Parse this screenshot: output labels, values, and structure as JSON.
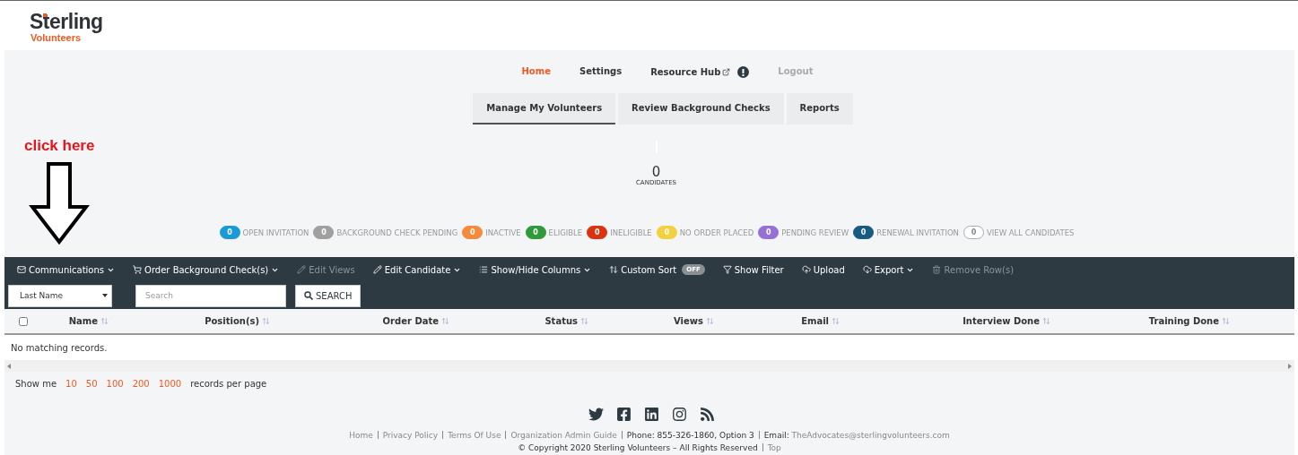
{
  "logo": {
    "name": "Sterling",
    "sub": "Volunteers"
  },
  "nav": [
    {
      "label": "Home",
      "selected": true,
      "kind": "link"
    },
    {
      "label": "Settings",
      "selected": false,
      "kind": "link"
    },
    {
      "label": "Resource Hub",
      "selected": false,
      "kind": "external"
    },
    {
      "label": "Logout",
      "selected": false,
      "kind": "disabled"
    }
  ],
  "tabs": [
    {
      "label": "Manage My Volunteers",
      "selected": true
    },
    {
      "label": "Review Background Checks",
      "selected": false
    },
    {
      "label": "Reports",
      "selected": false
    }
  ],
  "annotation": {
    "text": "click here"
  },
  "counter": {
    "value": "0",
    "label": "CANDIDATES"
  },
  "statuses": [
    {
      "count": "0",
      "label": "OPEN INVITATION",
      "color": "#1a9ad6"
    },
    {
      "count": "0",
      "label": "BACKGROUND CHECK PENDING",
      "color": "#a0a0a0"
    },
    {
      "count": "0",
      "label": "INACTIVE",
      "color": "#f58a3c"
    },
    {
      "count": "0",
      "label": "ELIGIBLE",
      "color": "#2e9a3a"
    },
    {
      "count": "0",
      "label": "INELIGIBLE",
      "color": "#d9340f"
    },
    {
      "count": "0",
      "label": "NO ORDER PLACED",
      "color": "#f3d03e"
    },
    {
      "count": "0",
      "label": "PENDING REVIEW",
      "color": "#9670d6"
    },
    {
      "count": "0",
      "label": "RENEWAL INVITATION",
      "color": "#175b82"
    },
    {
      "count": "0",
      "label": "VIEW ALL CANDIDATES",
      "color": "#ffffff"
    }
  ],
  "toolbar": [
    {
      "label": "Communications",
      "kind": "dropdown",
      "disabled": false
    },
    {
      "label": "Order Background Check(s)",
      "kind": "dropdown",
      "disabled": false
    },
    {
      "label": "Edit Views",
      "kind": "action",
      "disabled": true
    },
    {
      "label": "Edit Candidate",
      "kind": "dropdown",
      "disabled": false
    },
    {
      "label": "Show/Hide Columns",
      "kind": "dropdown",
      "disabled": false
    },
    {
      "label": "Custom Sort",
      "kind": "toggle",
      "disabled": false,
      "toggle_text": "OFF",
      "on": false
    },
    {
      "label": "Show Filter",
      "kind": "action",
      "disabled": false
    },
    {
      "label": "Upload",
      "kind": "action",
      "disabled": false
    },
    {
      "label": "Export",
      "kind": "dropdown",
      "disabled": false
    },
    {
      "label": "Remove Row(s)",
      "kind": "action",
      "disabled": true
    }
  ],
  "filter": {
    "field": "Last Name",
    "placeholder": "Search",
    "button": "SEARCH"
  },
  "table": {
    "select_all": {
      "checked": false
    },
    "columns": [
      "Name",
      "Position(s)",
      "Order Date",
      "Status",
      "Views",
      "Email",
      "Interview Done",
      "Training Done"
    ],
    "empty": "No matching records."
  },
  "pager": {
    "label": "Show me",
    "sizes": [
      "10",
      "50",
      "100",
      "200",
      "1000"
    ],
    "suffix": "records per page"
  },
  "footer": {
    "links": [
      {
        "text": "Home",
        "kind": "link"
      },
      {
        "text": "Privacy Policy",
        "kind": "link"
      },
      {
        "text": "Terms Of Use",
        "kind": "link"
      },
      {
        "text": "Organization Admin Guide",
        "kind": "link"
      },
      {
        "text": "Phone: 855-326-1860, Option 3",
        "kind": "text"
      },
      {
        "text": "Email:",
        "kind": "text",
        "link": "TheAdvocates@sterlingvolunteers.com"
      }
    ],
    "copyright": "© Copyright 2020 Sterling Volunteers – All Rights Reserved",
    "top": "Top"
  }
}
